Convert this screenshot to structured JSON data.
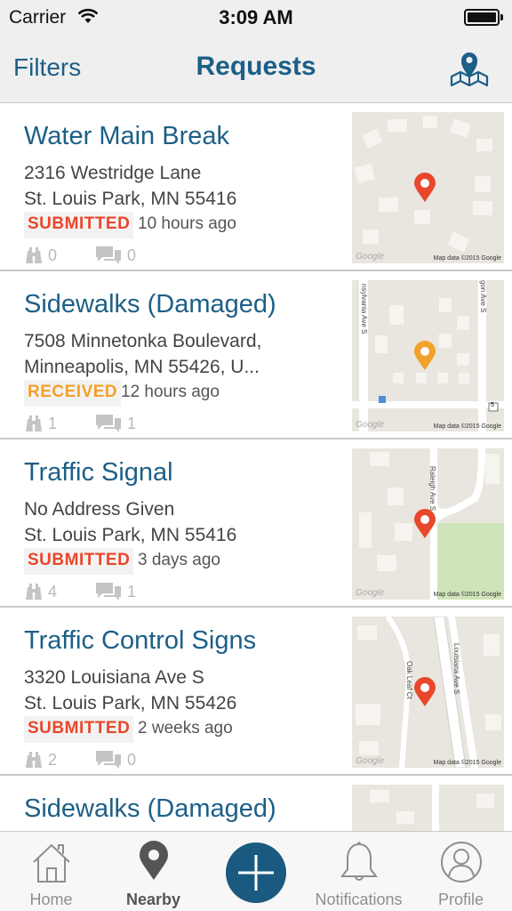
{
  "status_bar": {
    "carrier": "Carrier",
    "time": "3:09 AM"
  },
  "nav": {
    "left_button": "Filters",
    "title": "Requests",
    "right_icon": "map-pin-icon"
  },
  "colors": {
    "brand": "#1c5f87",
    "submitted": "#e8472b",
    "received": "#f2a12a",
    "pin_red": "#e8472b",
    "pin_orange": "#f2a12a"
  },
  "requests": [
    {
      "title": "Water Main Break",
      "address_line1": "2316 Westridge Lane",
      "address_line2": "St. Louis Park, MN 55416",
      "status": "SUBMITTED",
      "time": "10 hours ago",
      "watchers": "0",
      "comments": "0",
      "map_attribution": "Map data ©2015 Google",
      "map_logo": "Google"
    },
    {
      "title": "Sidewalks (Damaged)",
      "address_line1": "7508 Minnetonka Boulevard,",
      "address_line2": "Minneapolis, MN 55426, U...",
      "status": "RECEIVED",
      "time": "12 hours ago",
      "watchers": "1",
      "comments": "1",
      "map_attribution": "Map data ©2015 Google",
      "map_logo": "Google",
      "map_streets": [
        "nsylvania Ave S",
        "gon Ave S"
      ],
      "map_route_shield": "5"
    },
    {
      "title": "Traffic Signal",
      "address_line1": "No Address Given",
      "address_line2": "St. Louis Park, MN 55416",
      "status": "SUBMITTED",
      "time": "3 days ago",
      "watchers": "4",
      "comments": "1",
      "map_attribution": "Map data ©2015 Google",
      "map_logo": "Google",
      "map_streets": [
        "Raleigh Ave S"
      ]
    },
    {
      "title": "Traffic Control Signs",
      "address_line1": "3320 Louisiana Ave S",
      "address_line2": "St. Louis Park, MN 55426",
      "status": "SUBMITTED",
      "time": "2 weeks ago",
      "watchers": "2",
      "comments": "0",
      "map_attribution": "Map data ©2015 Google",
      "map_logo": "Google",
      "map_streets": [
        "Louisiana Ave S",
        "Oak Leaf Ct"
      ]
    },
    {
      "title": "Sidewalks (Damaged)"
    }
  ],
  "tabs": [
    {
      "label": "Home",
      "icon": "home-icon"
    },
    {
      "label": "Nearby",
      "icon": "location-pin-icon",
      "active": true
    },
    {
      "label": "",
      "icon": "add-icon"
    },
    {
      "label": "Notifications",
      "icon": "bell-icon"
    },
    {
      "label": "Profile",
      "icon": "user-icon"
    }
  ]
}
